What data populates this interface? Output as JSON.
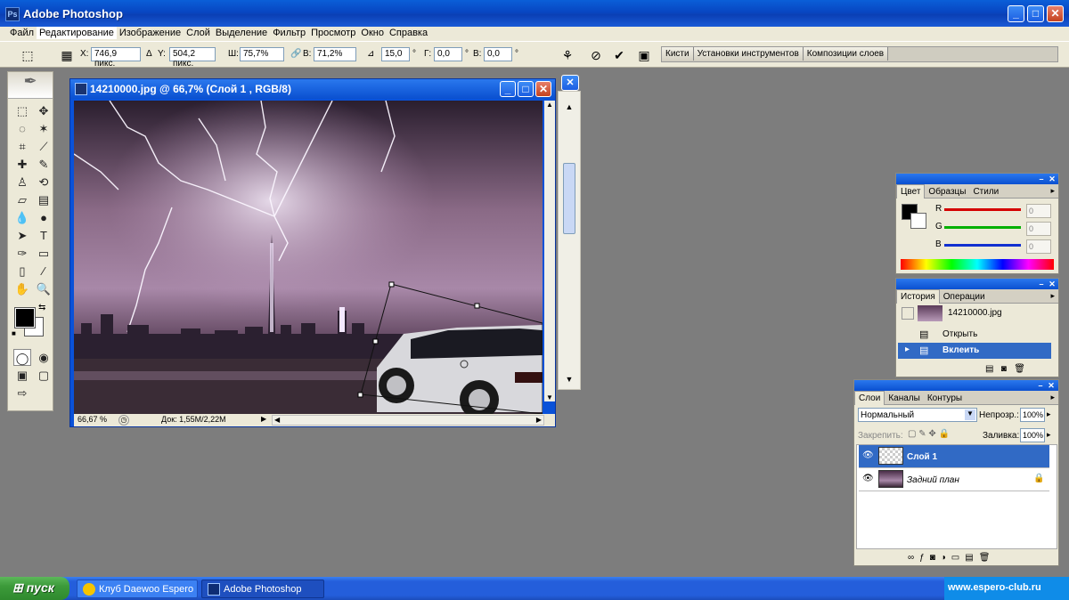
{
  "app": {
    "title": "Adobe Photoshop",
    "icon_text": "Ps"
  },
  "menu": [
    "Файл",
    "Редактирование",
    "Изображение",
    "Слой",
    "Выделение",
    "Фильтр",
    "Просмотр",
    "Окно",
    "Справка"
  ],
  "options": {
    "x_label": "X:",
    "x_value": "746,9 пикс.",
    "y_label": "Y:",
    "y_value": "504,2 пикс.",
    "w_label": "Ш:",
    "w_value": "75,7%",
    "h_label": "В:",
    "h_value": "71,2%",
    "angle_value": "15,0",
    "deg": "°",
    "hskew_label": "Г:",
    "hskew_value": "0,0",
    "vskew_label": "В:",
    "vskew_value": "0,0"
  },
  "palette_well": [
    "Кисти",
    "Установки инструментов",
    "Композиции слоев"
  ],
  "document": {
    "title": "14210000.jpg @ 66,7% (Слой 1 , RGB/8)",
    "zoom": "66,67 %",
    "doc_size": "Док: 1,55M/2,22M"
  },
  "color_palette": {
    "tabs": [
      "Цвет",
      "Образцы",
      "Стили"
    ],
    "channels": [
      {
        "label": "R",
        "value": "0",
        "color": "#d40000"
      },
      {
        "label": "G",
        "value": "0",
        "color": "#00b000"
      },
      {
        "label": "B",
        "value": "0",
        "color": "#1030d0"
      }
    ]
  },
  "history_palette": {
    "tabs": [
      "История",
      "Операции"
    ],
    "snapshot": "14210000.jpg",
    "states": [
      "Открыть",
      "Вклеить"
    ]
  },
  "layers_palette": {
    "tabs": [
      "Слои",
      "Каналы",
      "Контуры"
    ],
    "blend_mode": "Нормальный",
    "opacity_label": "Непрозр.:",
    "opacity_value": "100%",
    "lock_label": "Закрепить:",
    "fill_label": "Заливка:",
    "fill_value": "100%",
    "layers": [
      {
        "name": "Слой 1",
        "selected": true
      },
      {
        "name": "Задний план",
        "selected": false
      }
    ]
  },
  "taskbar": {
    "start": "пуск",
    "tasks": [
      "Клуб Daewoo Espero ...",
      "Adobe Photoshop"
    ],
    "tray_text": "www.espero-club.ru"
  }
}
